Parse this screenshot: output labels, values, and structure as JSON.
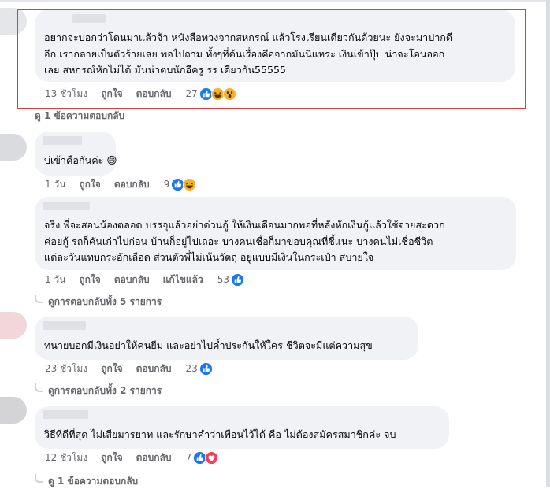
{
  "comments": [
    {
      "lines": [
        "อยากจะบอกว่าโดนมาแล้วจ้า หนังสือทวงจากสหกรณ์ แล้วโรงเรียนเดียวกันด้วยนะ ยังจะมาปากดี",
        "อีก เรากลายเป็นตัวร้ายเลย พอไปถาม ทั้งๆที่ต้นเรื่องคือจากมันนี่แหระ เงินเข้าปุ๊ป น่าจะโอนออก",
        "เลย สหกรณ์หักไม่ได้ มันน่าตบนักอีครู รร เดียวกัน55555"
      ],
      "time": "13 ชั่วโมง",
      "like": "ถูกใจ",
      "reply": "ตอบกลับ",
      "reaction_count": "27",
      "reactions": [
        "like-icon",
        "haha-icon",
        "wow-icon"
      ],
      "replies_link": "ดู 1 ข้อความตอบกลับ"
    },
    {
      "lines": [
        "บ่เข้าคือกันค่ะ 😄"
      ],
      "time": "1 วัน",
      "like": "ถูกใจ",
      "reply": "ตอบกลับ",
      "reaction_count": "9",
      "reactions": [
        "like-icon",
        "haha-icon"
      ]
    },
    {
      "lines": [
        "จริง พี่จะสอนน้องตลอด บรรจุแล้วอย่าด่วนกู้ ให้เงินเดือนมากพอที่หลังหักเงินกู้แล้วใช้จ่ายสะดวก",
        "ค่อยกู้ รถก็คันเก่าไปก่อน บ้านก็อยู่ไปเถอะ บางคนเชื่อก็มาขอบคุณที่ชี้แนะ บางคนไม่เชื่อชีวิต",
        "แต่ละวันแทบกระอักเลือด ส่วนตัวพี่ไม่เน้นวัตถุ อยู่แบบมีเงินในกระเป๋า สบายใจ"
      ],
      "time": "1 วัน",
      "like": "ถูกใจ",
      "reply": "ตอบกลับ",
      "edited": "แก้ไขแล้ว",
      "reaction_count": "53",
      "reactions": [
        "like-icon"
      ],
      "replies_link": "ดูการตอบกลับทั้ง 5 รายการ"
    },
    {
      "lines": [
        "ทนายบอกมีเงินอย่าให้คนยืม และอย่าไปค้ำประกันให้ใคร ชีวิตจะมีแต่ความสุข"
      ],
      "time": "23 ชั่วโมง",
      "like": "ถูกใจ",
      "reply": "ตอบกลับ",
      "reaction_count": "23",
      "reactions": [
        "like-icon"
      ],
      "replies_link": "ดูการตอบกลับทั้ง 2 รายการ"
    },
    {
      "lines": [
        "วิธีที่ดีที่สุด ไม่เสียมารยาท และรักษาคำว่าเพื่อนไว้ได้ คือ ไม่ต้องสมัครสมาชิกค่ะ จบ"
      ],
      "time": "12 ชั่วโมง",
      "like": "ถูกใจ",
      "reply": "ตอบกลับ",
      "reaction_count": "7",
      "reactions": [
        "like-icon",
        "love-icon"
      ],
      "replies_link": "ดู 1 ข้อความตอบกลับ"
    }
  ],
  "colors": {
    "bubble": "#f0f2f5",
    "meta_text": "#65676b",
    "like_blue": "#1877f2",
    "haha_yellow": "#f7b125",
    "love_red": "#f33e58",
    "highlight_border": "#e5393a"
  }
}
